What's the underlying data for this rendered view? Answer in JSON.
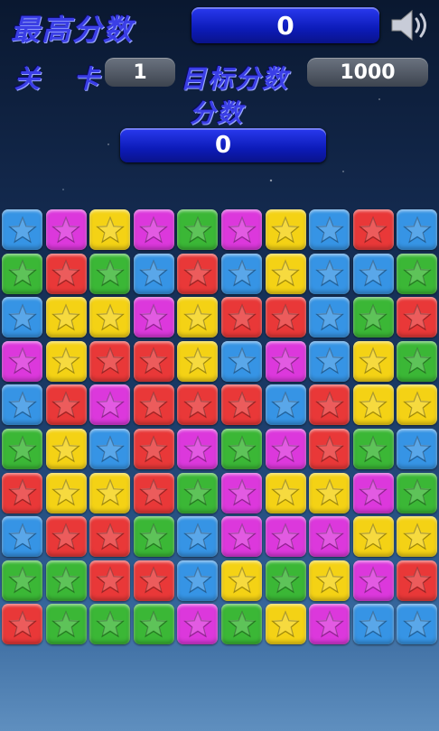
{
  "hud": {
    "best_score_label": "最高分数",
    "best_score_value": "0",
    "level_label": "关 卡",
    "level_value": "1",
    "target_label": "目标分数",
    "target_value": "1000",
    "score_label": "分数",
    "score_value": "0",
    "sound_icon": "speaker-icon"
  },
  "colors": {
    "blue": "#3a93e0",
    "pink": "#d63ad6",
    "yellow": "#f2d21e",
    "green": "#3fb53a",
    "red": "#e23a3a"
  },
  "board": {
    "columns": 10,
    "rows": 10,
    "tiles": [
      [
        "B",
        "P",
        "Y",
        "P",
        "G",
        "P",
        "Y",
        "B",
        "R",
        "B"
      ],
      [
        "G",
        "R",
        "G",
        "B",
        "R",
        "B",
        "Y",
        "B",
        "B",
        "G"
      ],
      [
        "B",
        "Y",
        "Y",
        "P",
        "Y",
        "R",
        "R",
        "B",
        "G",
        "R"
      ],
      [
        "P",
        "Y",
        "R",
        "R",
        "Y",
        "B",
        "P",
        "B",
        "Y",
        "G"
      ],
      [
        "B",
        "R",
        "P",
        "R",
        "R",
        "R",
        "B",
        "R",
        "Y",
        "Y"
      ],
      [
        "G",
        "Y",
        "B",
        "R",
        "P",
        "G",
        "P",
        "R",
        "G",
        "B"
      ],
      [
        "R",
        "Y",
        "Y",
        "R",
        "G",
        "P",
        "Y",
        "Y",
        "P",
        "G"
      ],
      [
        "B",
        "R",
        "R",
        "G",
        "B",
        "P",
        "P",
        "P",
        "Y",
        "Y"
      ],
      [
        "G",
        "G",
        "R",
        "R",
        "B",
        "Y",
        "G",
        "Y",
        "P",
        "R"
      ],
      [
        "R",
        "G",
        "G",
        "G",
        "P",
        "G",
        "Y",
        "P",
        "B",
        "B"
      ]
    ]
  }
}
